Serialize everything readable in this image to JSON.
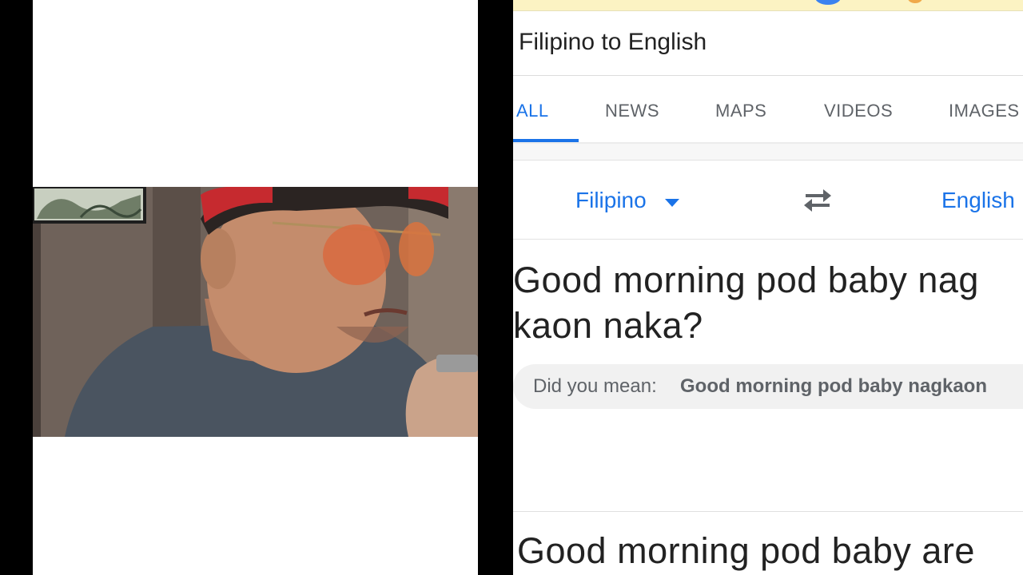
{
  "search": {
    "query": "Filipino to English",
    "tabs": [
      {
        "label": "ALL",
        "active": true
      },
      {
        "label": "NEWS",
        "active": false
      },
      {
        "label": "MAPS",
        "active": false
      },
      {
        "label": "VIDEOS",
        "active": false
      },
      {
        "label": "IMAGES",
        "active": false
      }
    ]
  },
  "translate": {
    "source_language": "Filipino",
    "target_language": "English",
    "swap_icon": "swap-arrows-icon",
    "source_lines": [
      "Good morning pod baby nag",
      "kaon naka?"
    ],
    "did_you_mean_label": "Did you mean:",
    "did_you_mean_text": "Good morning pod baby nagkaon",
    "result_text": "Good morning pod baby are"
  },
  "colors": {
    "accent": "#1a73e8",
    "text": "#222222",
    "muted": "#5f6368",
    "top_strip": "#fcf3c3"
  }
}
